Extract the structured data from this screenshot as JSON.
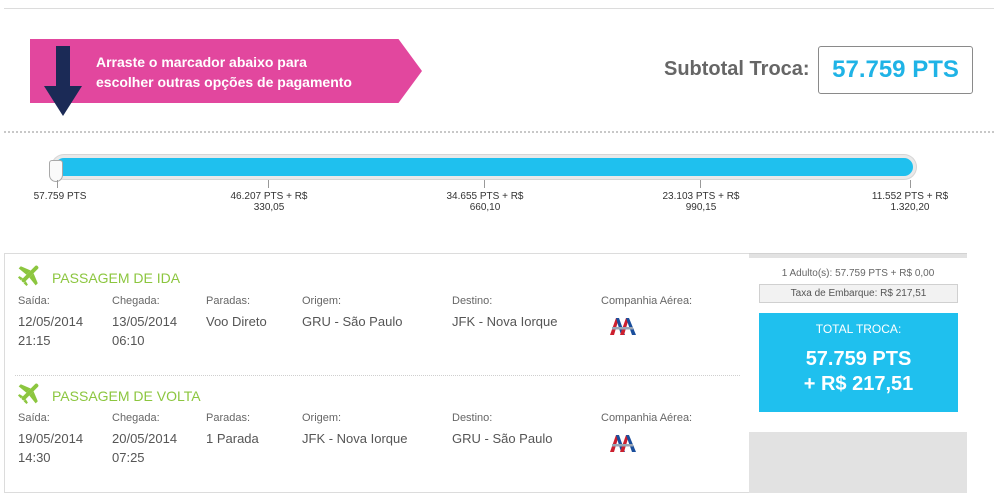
{
  "banner": {
    "line1": "Arraste o marcador abaixo para",
    "line2": "escolher outras opções de pagamento"
  },
  "subtotal": {
    "label": "Subtotal Troca:",
    "value": "57.759 PTS"
  },
  "slider": {
    "position": 0,
    "ticks": [
      {
        "line1": "57.759 PTS",
        "line2": ""
      },
      {
        "line1": "46.207 PTS + R$",
        "line2": "330,05"
      },
      {
        "line1": "34.655 PTS + R$",
        "line2": "660,10"
      },
      {
        "line1": "23.103 PTS + R$",
        "line2": "990,15"
      },
      {
        "line1": "11.552 PTS + R$",
        "line2": "1.320,20"
      }
    ]
  },
  "labels": {
    "saida": "Saída:",
    "chegada": "Chegada:",
    "paradas": "Paradas:",
    "origem": "Origem:",
    "destino": "Destino:",
    "companhia": "Companhia Aérea:"
  },
  "legs": [
    {
      "title": "PASSAGEM DE IDA",
      "saida_date": "12/05/2014",
      "saida_time": "21:15",
      "chegada_date": "13/05/2014",
      "chegada_time": "06:10",
      "paradas": "Voo Direto",
      "origem": "GRU - São Paulo",
      "destino": "JFK - Nova Iorque",
      "airline_icon": "american-airlines-logo"
    },
    {
      "title": "PASSAGEM DE VOLTA",
      "saida_date": "19/05/2014",
      "saida_time": "14:30",
      "chegada_date": "20/05/2014",
      "chegada_time": "07:25",
      "paradas": "1 Parada",
      "origem": "JFK - Nova Iorque",
      "destino": "GRU - São Paulo",
      "airline_icon": "american-airlines-logo"
    }
  ],
  "summary": {
    "pax": "1 Adulto(s): 57.759 PTS + R$ 0,00",
    "tax": "Taxa de Embarque: R$ 217,51",
    "total_label": "TOTAL TROCA:",
    "total_pts": "57.759 PTS",
    "total_brl": "+ R$ 217,51"
  },
  "colors": {
    "accent_blue": "#1fc0ee",
    "banner_pink": "#e2479e",
    "leg_green": "#8cc63f",
    "arrow_navy": "#1b2a56"
  }
}
